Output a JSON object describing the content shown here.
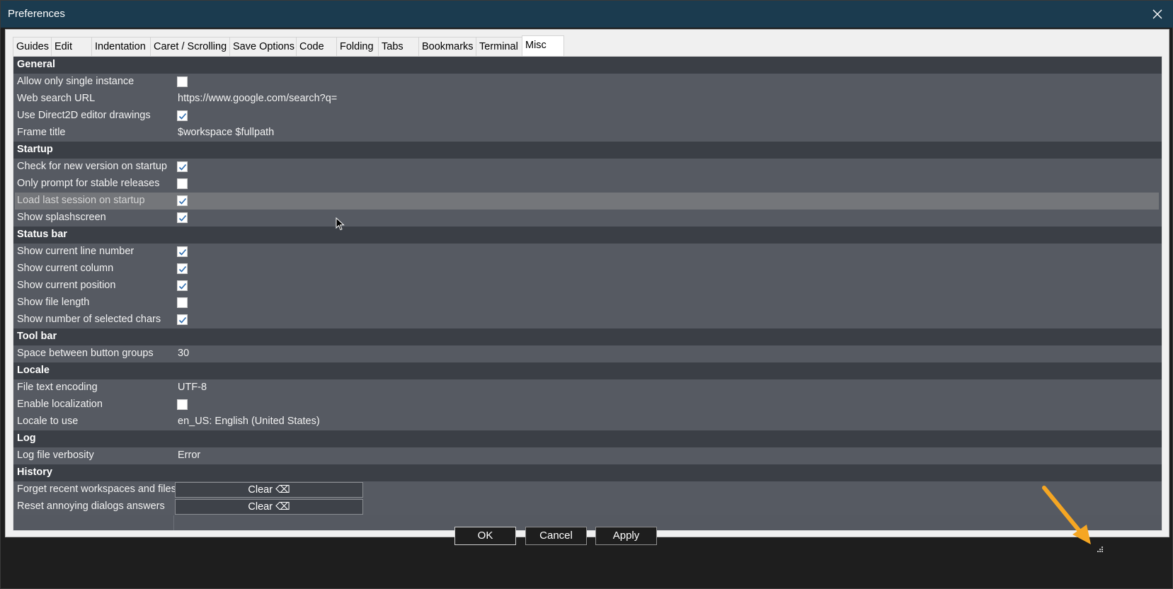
{
  "window": {
    "title": "Preferences"
  },
  "tabs": [
    {
      "label": "Guides"
    },
    {
      "label": "Edit"
    },
    {
      "label": "Indentation"
    },
    {
      "label": "Caret / Scrolling"
    },
    {
      "label": "Save Options"
    },
    {
      "label": "Code"
    },
    {
      "label": "Folding"
    },
    {
      "label": "Tabs"
    },
    {
      "label": "Bookmarks"
    },
    {
      "label": "Terminal"
    },
    {
      "label": "Misc"
    }
  ],
  "active_tab": "Misc",
  "sections": {
    "general": {
      "title": "General",
      "allow_single_instance": {
        "label": "Allow only single instance",
        "checked": false
      },
      "web_search_url": {
        "label": "Web search URL",
        "value": "https://www.google.com/search?q="
      },
      "use_direct2d": {
        "label": "Use Direct2D editor drawings",
        "checked": true
      },
      "frame_title": {
        "label": "Frame title",
        "value": "$workspace $fullpath"
      }
    },
    "startup": {
      "title": "Startup",
      "check_new_version": {
        "label": "Check for new version on startup",
        "checked": true
      },
      "prompt_stable": {
        "label": "Only prompt for stable releases",
        "checked": false
      },
      "load_last_session": {
        "label": "Load last session on startup",
        "checked": true,
        "selected": true
      },
      "show_splash": {
        "label": "Show splashscreen",
        "checked": true
      }
    },
    "status_bar": {
      "title": "Status bar",
      "line_number": {
        "label": "Show current line number",
        "checked": true
      },
      "column": {
        "label": "Show current column",
        "checked": true
      },
      "position": {
        "label": "Show current position",
        "checked": true
      },
      "file_length": {
        "label": "Show file length",
        "checked": false
      },
      "selected_chars": {
        "label": "Show number of selected chars",
        "checked": true
      }
    },
    "tool_bar": {
      "title": "Tool bar",
      "space_groups": {
        "label": "Space between button groups",
        "value": "30"
      }
    },
    "locale": {
      "title": "Locale",
      "encoding": {
        "label": "File text encoding",
        "value": "UTF-8"
      },
      "enable_localization": {
        "label": "Enable localization",
        "checked": false
      },
      "locale_to_use": {
        "label": "Locale to use",
        "value": "en_US: English (United States)"
      }
    },
    "log": {
      "title": "Log",
      "verbosity": {
        "label": "Log file verbosity",
        "value": "Error"
      }
    },
    "history": {
      "title": "History",
      "forget_recent": {
        "label": "Forget recent workspaces and files",
        "button": "Clear ⌫"
      },
      "reset_dialogs": {
        "label": "Reset annoying dialogs answers",
        "button": "Clear ⌫"
      }
    }
  },
  "buttons": {
    "ok": "OK",
    "cancel": "Cancel",
    "apply": "Apply"
  },
  "colors": {
    "titlebar": "#1b3b4f",
    "grid_bg": "#555961",
    "section_bg": "#3b3f46",
    "annotation_arrow": "#f5a623"
  }
}
